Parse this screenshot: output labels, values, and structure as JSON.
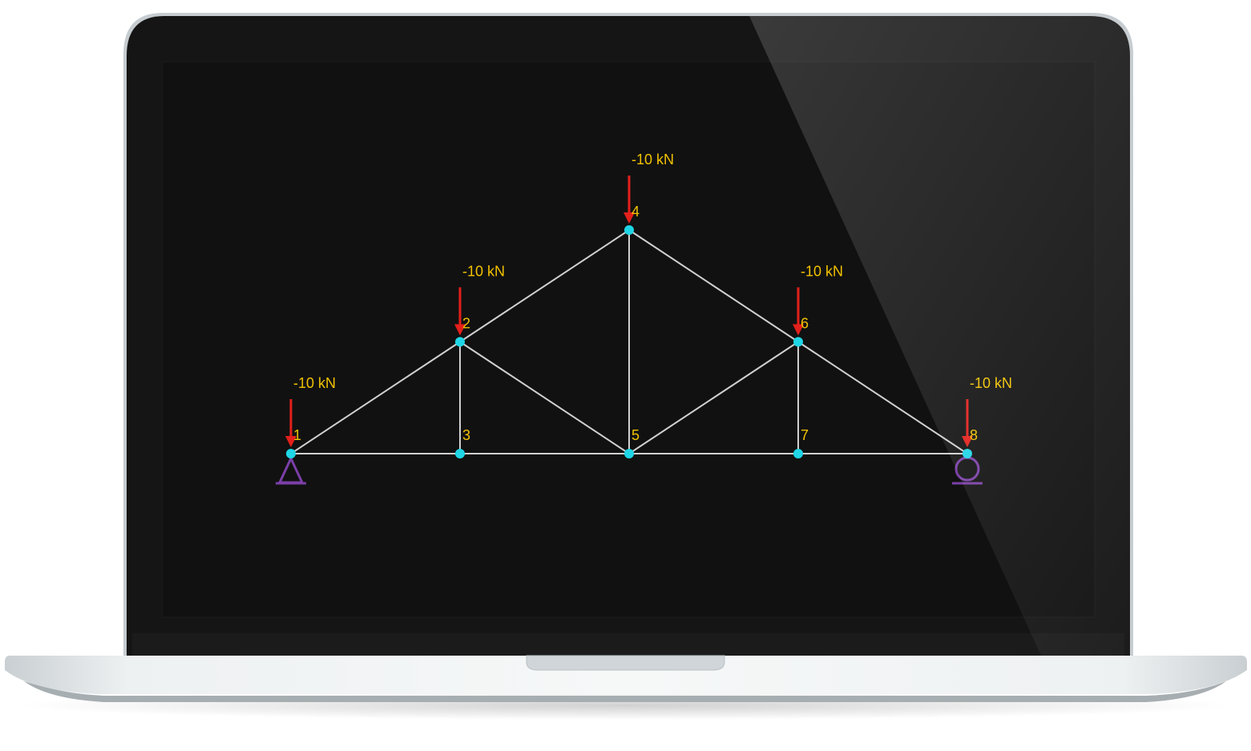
{
  "colors": {
    "background": "#ffffff",
    "bezel": "#151515",
    "screen": "#111111",
    "member": "#d0d0d0",
    "node": "#1fd6e6",
    "load_arrow": "#e3201b",
    "label": "#f2c200",
    "support": "#7b3fa8"
  },
  "nodes": [
    {
      "id": "1",
      "x": 0,
      "y": 0
    },
    {
      "id": "2",
      "x": 1,
      "y": 1
    },
    {
      "id": "3",
      "x": 1,
      "y": 0
    },
    {
      "id": "4",
      "x": 2,
      "y": 2
    },
    {
      "id": "5",
      "x": 2,
      "y": 0
    },
    {
      "id": "6",
      "x": 3,
      "y": 1
    },
    {
      "id": "7",
      "x": 3,
      "y": 0
    },
    {
      "id": "8",
      "x": 4,
      "y": 0
    }
  ],
  "members": [
    [
      "1",
      "2"
    ],
    [
      "2",
      "4"
    ],
    [
      "4",
      "6"
    ],
    [
      "6",
      "8"
    ],
    [
      "1",
      "3"
    ],
    [
      "3",
      "5"
    ],
    [
      "5",
      "7"
    ],
    [
      "7",
      "8"
    ],
    [
      "2",
      "3"
    ],
    [
      "2",
      "5"
    ],
    [
      "4",
      "5"
    ],
    [
      "5",
      "6"
    ],
    [
      "6",
      "7"
    ]
  ],
  "loads": [
    {
      "node": "1",
      "label": "-10 kN"
    },
    {
      "node": "2",
      "label": "-10 kN"
    },
    {
      "node": "4",
      "label": "-10 kN"
    },
    {
      "node": "6",
      "label": "-10 kN"
    },
    {
      "node": "8",
      "label": "-10 kN"
    }
  ],
  "supports": [
    {
      "node": "1",
      "type": "pin"
    },
    {
      "node": "8",
      "type": "roller"
    }
  ]
}
